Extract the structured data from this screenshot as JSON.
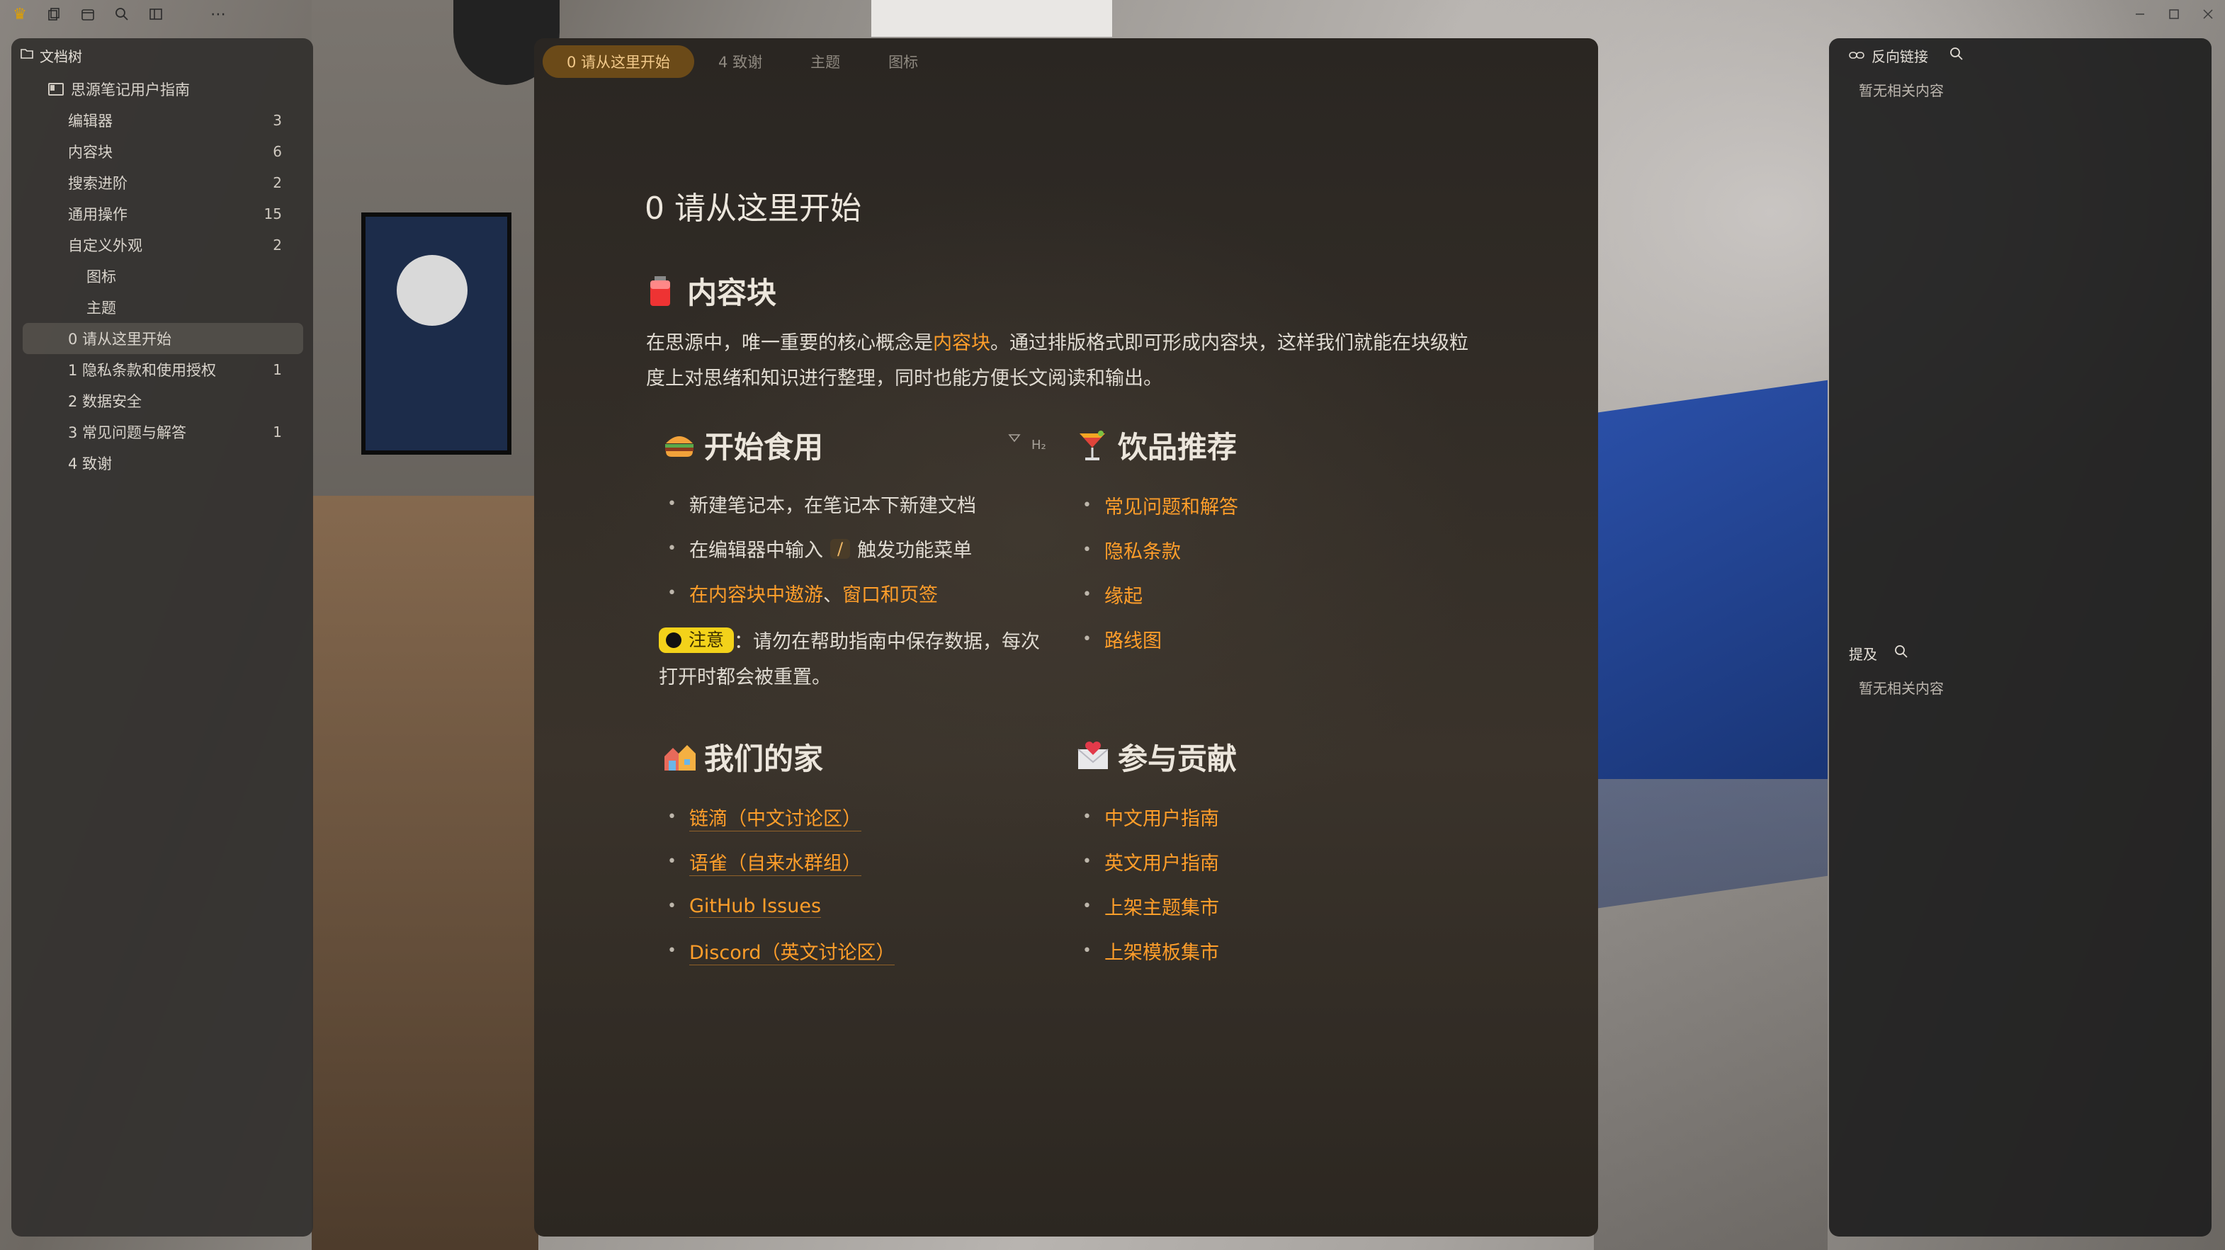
{
  "titlebar": {
    "left_icons": [
      "crown-icon",
      "copy-icon",
      "calendar-icon",
      "search-icon",
      "layout-icon",
      "more-icon"
    ],
    "right_icons": [
      "minimize-icon",
      "maximize-icon",
      "close-icon"
    ]
  },
  "filetree": {
    "header": "文档树",
    "notebook": "思源笔记用户指南",
    "items": [
      {
        "label": "编辑器",
        "count": "3",
        "level": 1
      },
      {
        "label": "内容块",
        "count": "6",
        "level": 1
      },
      {
        "label": "搜索进阶",
        "count": "2",
        "level": 1
      },
      {
        "label": "通用操作",
        "count": "15",
        "level": 1
      },
      {
        "label": "自定义外观",
        "count": "2",
        "level": 1
      },
      {
        "label": "图标",
        "count": "",
        "level": 2
      },
      {
        "label": "主题",
        "count": "",
        "level": 2
      },
      {
        "label": "0 请从这里开始",
        "count": "",
        "level": 1,
        "selected": true
      },
      {
        "label": "1 隐私条款和使用授权",
        "count": "1",
        "level": 1
      },
      {
        "label": "2 数据安全",
        "count": "",
        "level": 1
      },
      {
        "label": "3 常见问题与解答",
        "count": "1",
        "level": 1
      },
      {
        "label": "4 致谢",
        "count": "",
        "level": 1
      }
    ]
  },
  "tabs": [
    {
      "label": "0 请从这里开始",
      "active": true
    },
    {
      "label": "4 致谢",
      "active": false
    },
    {
      "label": "主题",
      "active": false
    },
    {
      "label": "图标",
      "active": false
    }
  ],
  "doc": {
    "title": "0 请从这里开始",
    "section1": {
      "heading": "内容块",
      "para_before": "在思源中，唯一重要的核心概念是",
      "para_link": "内容块",
      "para_after": "。通过排版格式即可形成内容块，这样我们就能在块级粒度上对思绪和知识进行整理，同时也能方便长文阅读和输出。"
    },
    "getting_started": {
      "heading": "开始食用",
      "item1": "新建笔记本，在笔记本下新建文档",
      "item2_before": "在编辑器中输入",
      "item2_kbd": "/",
      "item2_after": "触发功能菜单",
      "item3_link1": "在内容块中遨游",
      "item3_sep": "、",
      "item3_link2": "窗口和页签",
      "note_label": "注意",
      "note_text": "：请勿在帮助指南中保存数据，每次打开时都会被重置。"
    },
    "h2_tools": {
      "fold_icon": "fold-icon",
      "level": "H₂"
    },
    "drinks": {
      "heading": "饮品推荐",
      "items": [
        "常见问题和解答",
        "隐私条款",
        "缘起",
        "路线图"
      ]
    },
    "home": {
      "heading": "我们的家",
      "items": [
        "链滴（中文讨论区）",
        "语雀（自来水群组）",
        "GitHub Issues",
        "Discord（英文讨论区）"
      ]
    },
    "contribute": {
      "heading": "参与贡献",
      "items": [
        "中文用户指南",
        "英文用户指南",
        "上架主题集市",
        "上架模板集市"
      ]
    }
  },
  "backlinks": {
    "header": "反向链接",
    "empty": "暂无相关内容"
  },
  "mentions": {
    "header": "提及",
    "empty": "暂无相关内容"
  },
  "colors": {
    "accent": "#ff9e2a",
    "tab_active_bg": "#6b4a18",
    "note_badge": "#f3d21a"
  }
}
